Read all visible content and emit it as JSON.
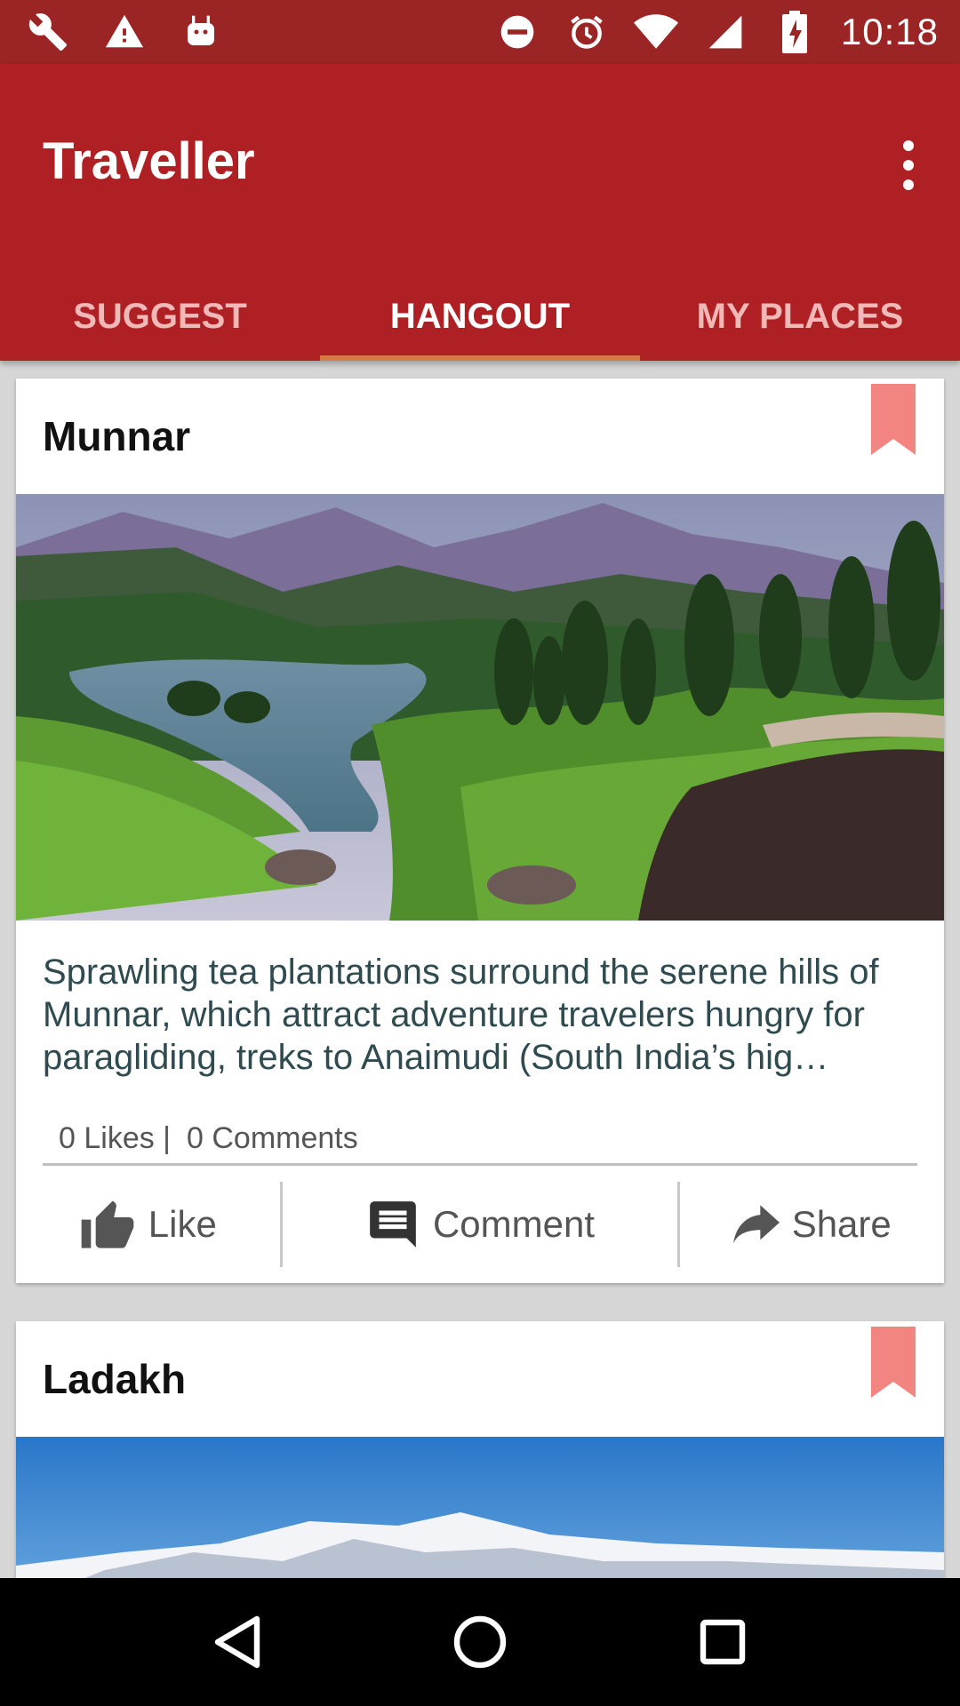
{
  "status_bar": {
    "time": "10:18",
    "left_icons": [
      "wrench-icon",
      "warning-icon",
      "android-icon"
    ],
    "right_icons": [
      "do-not-disturb-icon",
      "alarm-icon",
      "wifi-icon",
      "signal-icon",
      "battery-charging-icon"
    ]
  },
  "app": {
    "title": "Traveller",
    "primary_color": "#ae2023",
    "status_color": "#9b2424",
    "tab_indicator_color": "#d9784a"
  },
  "tabs": [
    {
      "label": "SUGGEST",
      "active": false
    },
    {
      "label": "HANGOUT",
      "active": true
    },
    {
      "label": "MY PLACES",
      "active": false
    }
  ],
  "cards": [
    {
      "title": "Munnar",
      "description": "Sprawling tea plantations surround the serene hills of Munnar, which attract adventure travelers hungry for paragliding, treks to Anaimudi (South India’s hig…",
      "likes": "0 Likes |",
      "comments": "0 Comments",
      "actions": {
        "like": "Like",
        "comment": "Comment",
        "share": "Share"
      },
      "image": "tea-plantation-landscape"
    },
    {
      "title": "Ladakh",
      "image": "snow-mountain-landscape"
    }
  ],
  "bookmark_color": "#f28482",
  "nav_bar": [
    "back-icon",
    "home-icon",
    "recents-icon"
  ]
}
